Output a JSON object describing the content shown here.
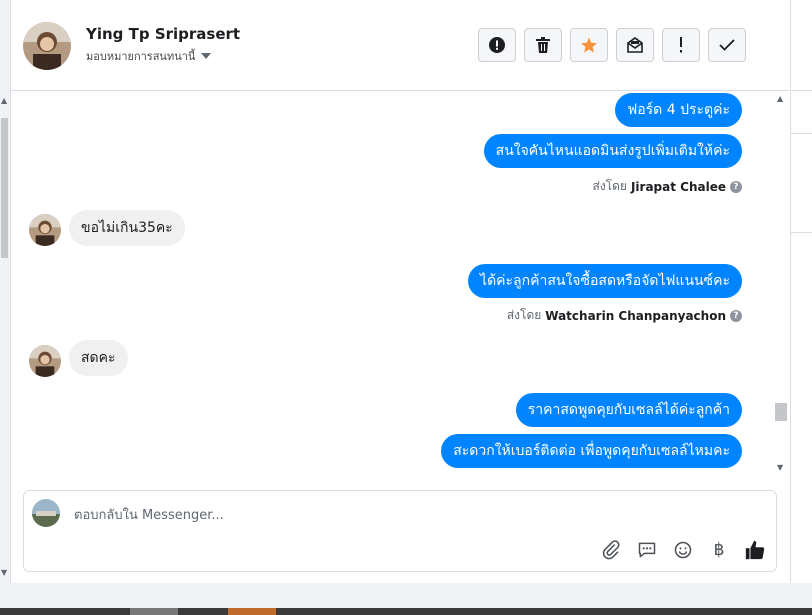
{
  "header": {
    "contact_name": "Ying Tp Sriprasert",
    "assign_label": "มอบหมายการสนทนานี้",
    "toolbar": [
      {
        "name": "spam-button",
        "icon": "alert-circle-icon"
      },
      {
        "name": "delete-button",
        "icon": "trash-icon"
      },
      {
        "name": "star-button",
        "icon": "star-icon",
        "color": "#f7923a"
      },
      {
        "name": "mark-unread-button",
        "icon": "envelope-icon"
      },
      {
        "name": "follow-up-button",
        "icon": "exclamation-icon"
      },
      {
        "name": "mark-done-button",
        "icon": "check-icon"
      }
    ]
  },
  "thread": {
    "messages": [
      {
        "dir": "out",
        "text": "ฟอร์ด 4 ประตูค่ะ"
      },
      {
        "dir": "out",
        "text": "สนใจคันไหนแอดมินส่งรูปเพิ่มเติมให้ค่ะ"
      },
      {
        "dir": "meta",
        "prefix": "ส่งโดย",
        "agent": "Jirapat Chalee"
      },
      {
        "dir": "in",
        "text": "ขอไม่เกิน35คะ"
      },
      {
        "dir": "out",
        "text": "ได้ค่ะลูกค้าสนใจซื้อสดหรือจัดไฟแนนซ์คะ"
      },
      {
        "dir": "meta",
        "prefix": "ส่งโดย",
        "agent": "Watcharin Chanpanyachon"
      },
      {
        "dir": "in",
        "text": "สดคะ"
      },
      {
        "dir": "out",
        "text": "ราคาสดพูดคุยกับเซลล์ได้ค่ะลูกค้า"
      },
      {
        "dir": "out",
        "text": "สะดวกให้เบอร์ติดต่อ เพื่อพูดคุยกับเซลล์ไหมคะ"
      }
    ]
  },
  "composer": {
    "placeholder": "ตอบกลับใน Messenger...",
    "tools": [
      "paperclip-icon",
      "saved-reply-icon",
      "emoji-icon",
      "baht-icon",
      "thumbs-up-icon"
    ],
    "baht_symbol": "฿"
  },
  "colors": {
    "accent": "#0084ff",
    "incoming_bubble": "#f0f0f0",
    "star": "#f7923a"
  }
}
